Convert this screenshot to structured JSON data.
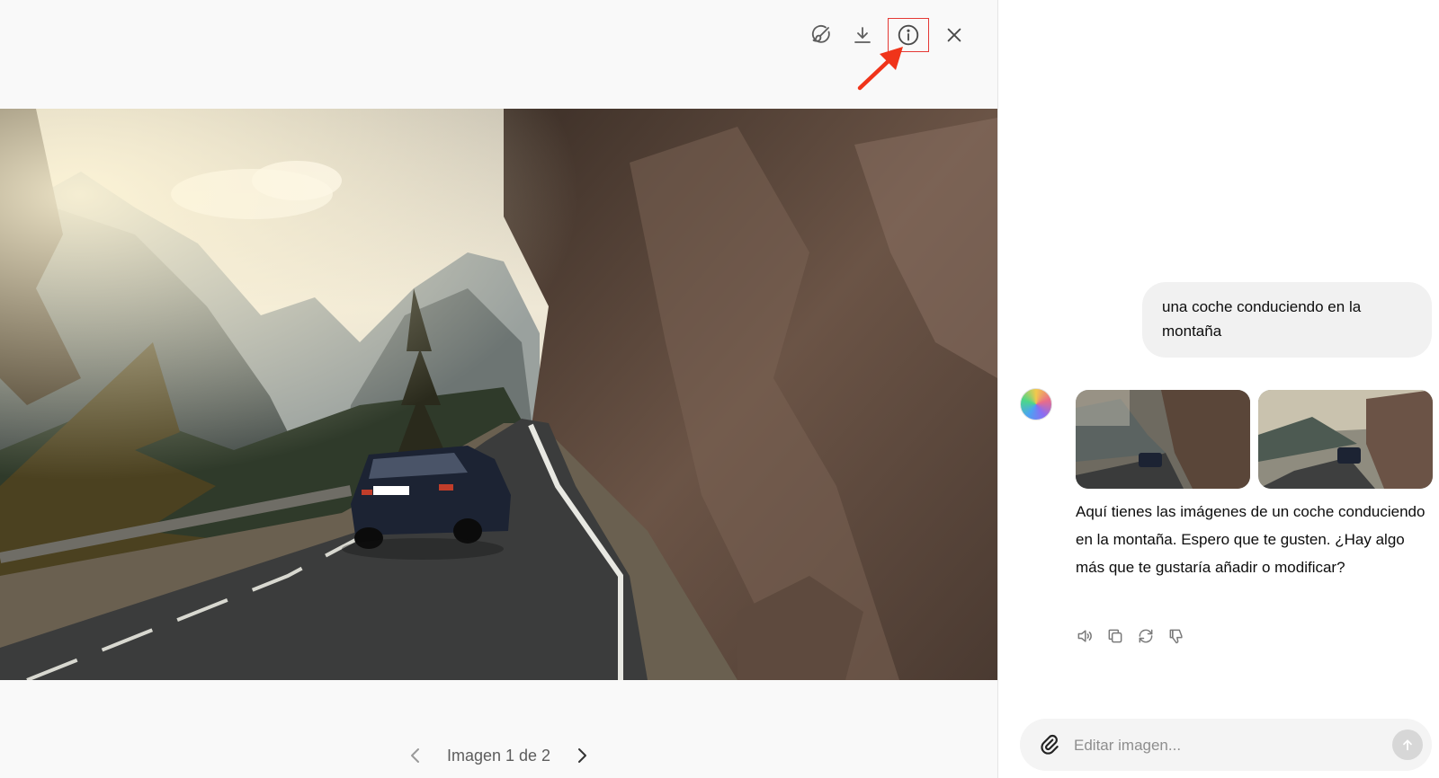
{
  "viewer": {
    "toolbar": {
      "edit_icon": "paint-brush-icon",
      "download_icon": "download-icon",
      "info_icon": "info-icon",
      "close_icon": "close-icon"
    },
    "image_alt": "",
    "pager": {
      "label": "Imagen 1 de 2"
    }
  },
  "chat": {
    "user_message": "una coche conduciendo en la montaña",
    "assistant_message": "Aquí tienes las imágenes de un coche conduciendo en la montaña. Espero que te gusten. ¿Hay algo más que te gustaría añadir o modificar?",
    "action_icons": [
      "speaker-icon",
      "copy-icon",
      "regenerate-icon",
      "thumbs-down-icon"
    ],
    "composer": {
      "placeholder": "Editar imagen..."
    }
  },
  "colors": {
    "highlight": "#e53935",
    "arrow": "#f0341a"
  }
}
